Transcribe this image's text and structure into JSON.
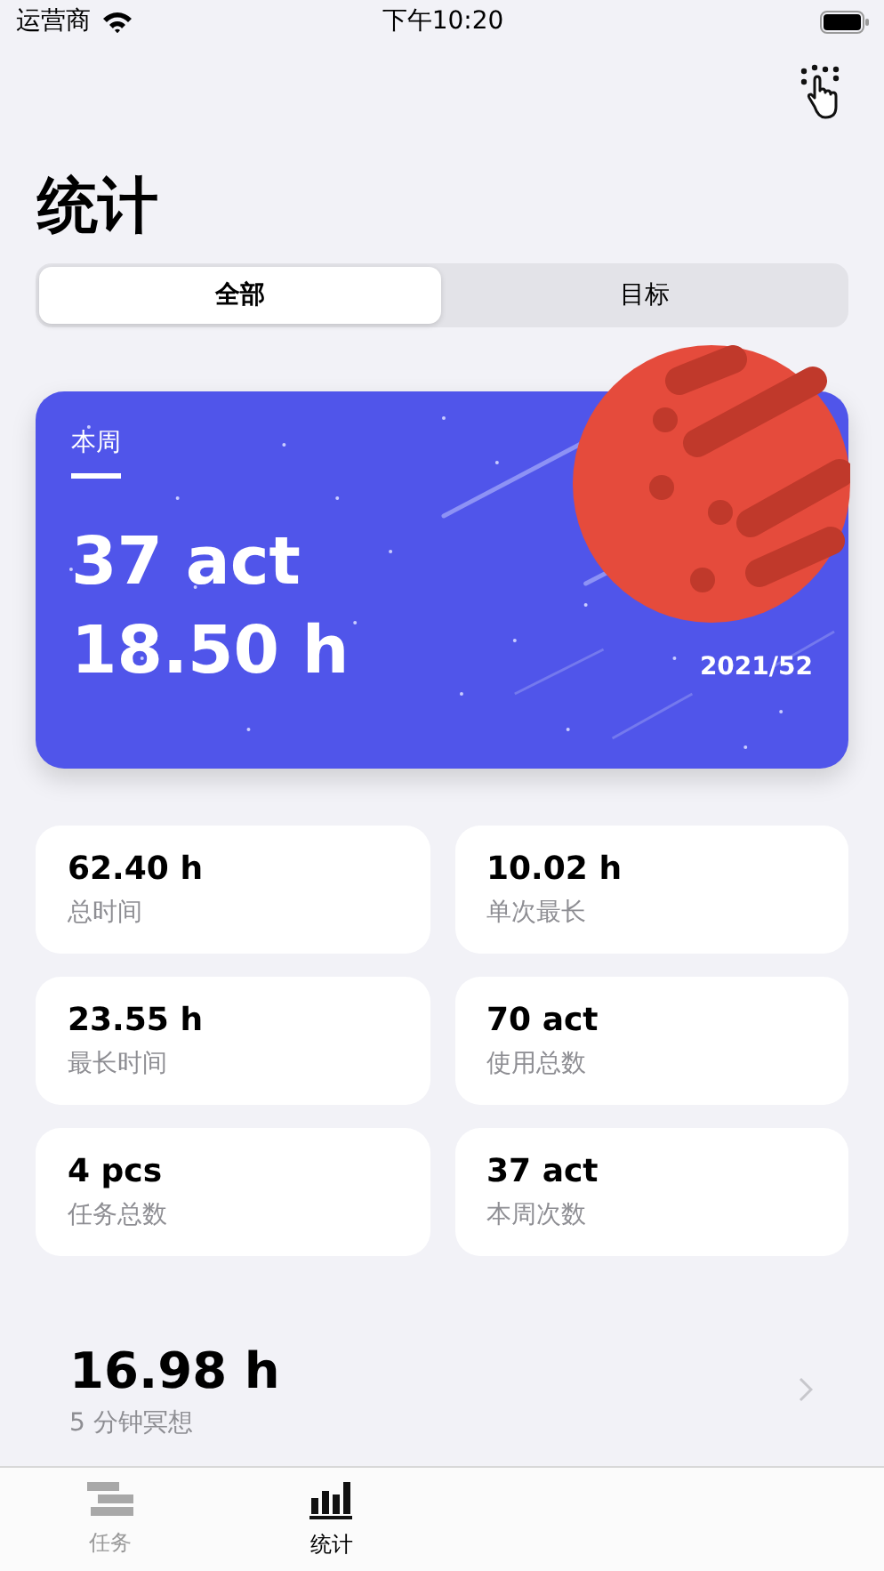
{
  "status_bar": {
    "carrier": "运营商",
    "time": "下午10:20"
  },
  "title": "统计",
  "segments": [
    {
      "label": "全部",
      "selected": true
    },
    {
      "label": "目标",
      "selected": false
    }
  ],
  "week_card": {
    "tab": {
      "label": "本周",
      "selected": true
    },
    "count": "37 act",
    "hours": "18.50 h",
    "week": "2021/52"
  },
  "stats": [
    {
      "value": "62.40 h",
      "label": "总时间"
    },
    {
      "value": "10.02 h",
      "label": "单次最长"
    },
    {
      "value": "23.55 h",
      "label": "最长时间"
    },
    {
      "value": "70 act",
      "label": "使用总数"
    },
    {
      "value": "4 pcs",
      "label": "任务总数"
    },
    {
      "value": "37 act",
      "label": "本周次数"
    }
  ],
  "summary": {
    "value": "16.98 h",
    "label": "5 分钟冥想"
  },
  "tab_bar": [
    {
      "label": "任务",
      "kind": "tasks",
      "selected": false
    },
    {
      "label": "统计",
      "kind": "stats",
      "selected": true
    }
  ]
}
